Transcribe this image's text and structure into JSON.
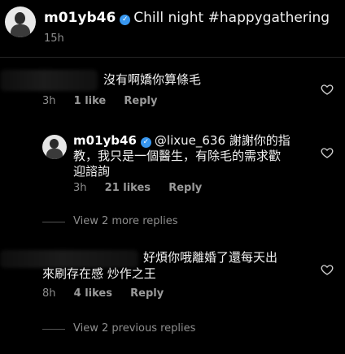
{
  "caption": {
    "username": "m01yb46",
    "text": "Chill night #happygathering",
    "time": "15h"
  },
  "comments": [
    {
      "text": "沒有啊嬌你算條毛",
      "time": "3h",
      "likes": "1 like",
      "reply_label": "Reply"
    },
    {
      "username": "m01yb46",
      "mention": "@lixue_636",
      "text_line1": "謝謝你的指",
      "text_line2": "教，我只是一個醫生，有除毛的需求歡",
      "text_line3": "迎諮詢",
      "time": "3h",
      "likes": "21 likes",
      "reply_label": "Reply"
    },
    {
      "text_line1": "好煩你哦離婚了還每天出",
      "text_line2": "來刷存在感 炒作之王",
      "time": "8h",
      "likes": "4 likes",
      "reply_label": "Reply"
    }
  ],
  "view_more_replies": "View 2 more replies",
  "view_previous_replies": "View 2 previous replies",
  "icons": {
    "heart": "heart-outline-icon",
    "verified": "verified-badge-icon"
  },
  "colors": {
    "background": "#000000",
    "verified": "#3897f0",
    "muted": "#8e8e8e"
  }
}
